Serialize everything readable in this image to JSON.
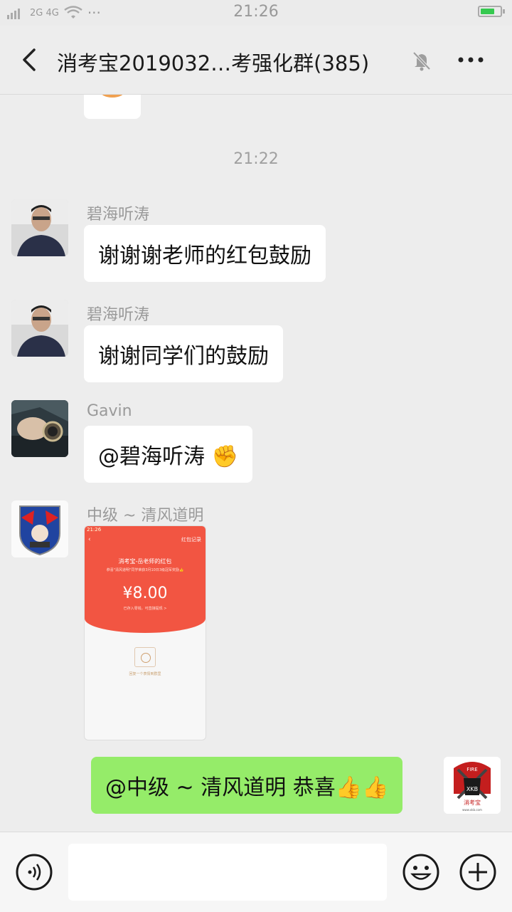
{
  "status_bar": {
    "signal_text": "2G 4G",
    "dots": "···",
    "time": "21:26"
  },
  "header": {
    "title": "消考宝2019032…考强化群(385)"
  },
  "chat": {
    "time_label": "21:22",
    "messages": [
      {
        "sender": "碧海听涛",
        "text": "谢谢谢老师的红包鼓励"
      },
      {
        "sender": "碧海听涛",
        "text": "谢谢同学们的鼓励"
      },
      {
        "sender": "Gavin",
        "text": "@碧海听涛 ✊"
      },
      {
        "sender": "中级 ~ 清风道明",
        "text": ""
      },
      {
        "sender": "",
        "text": "@中级 ~ 清风道明  恭喜👍👍"
      }
    ]
  },
  "red_packet": {
    "time": "21:26",
    "record_label": "红包记录",
    "from_label": "消考宝-岳老师的红包",
    "blessing": "恭喜\"清风道明\"同学荣获3月10日3级冠军奖励👍",
    "amount": "¥8.00",
    "note": "已存入零钱，可直接提现 >",
    "reply_label": "回复一个表情到群里"
  },
  "self_avatar": {
    "top_text": "FIRE",
    "badge_text": "XKB",
    "name": "消考宝",
    "url": "www.xkb.com"
  }
}
